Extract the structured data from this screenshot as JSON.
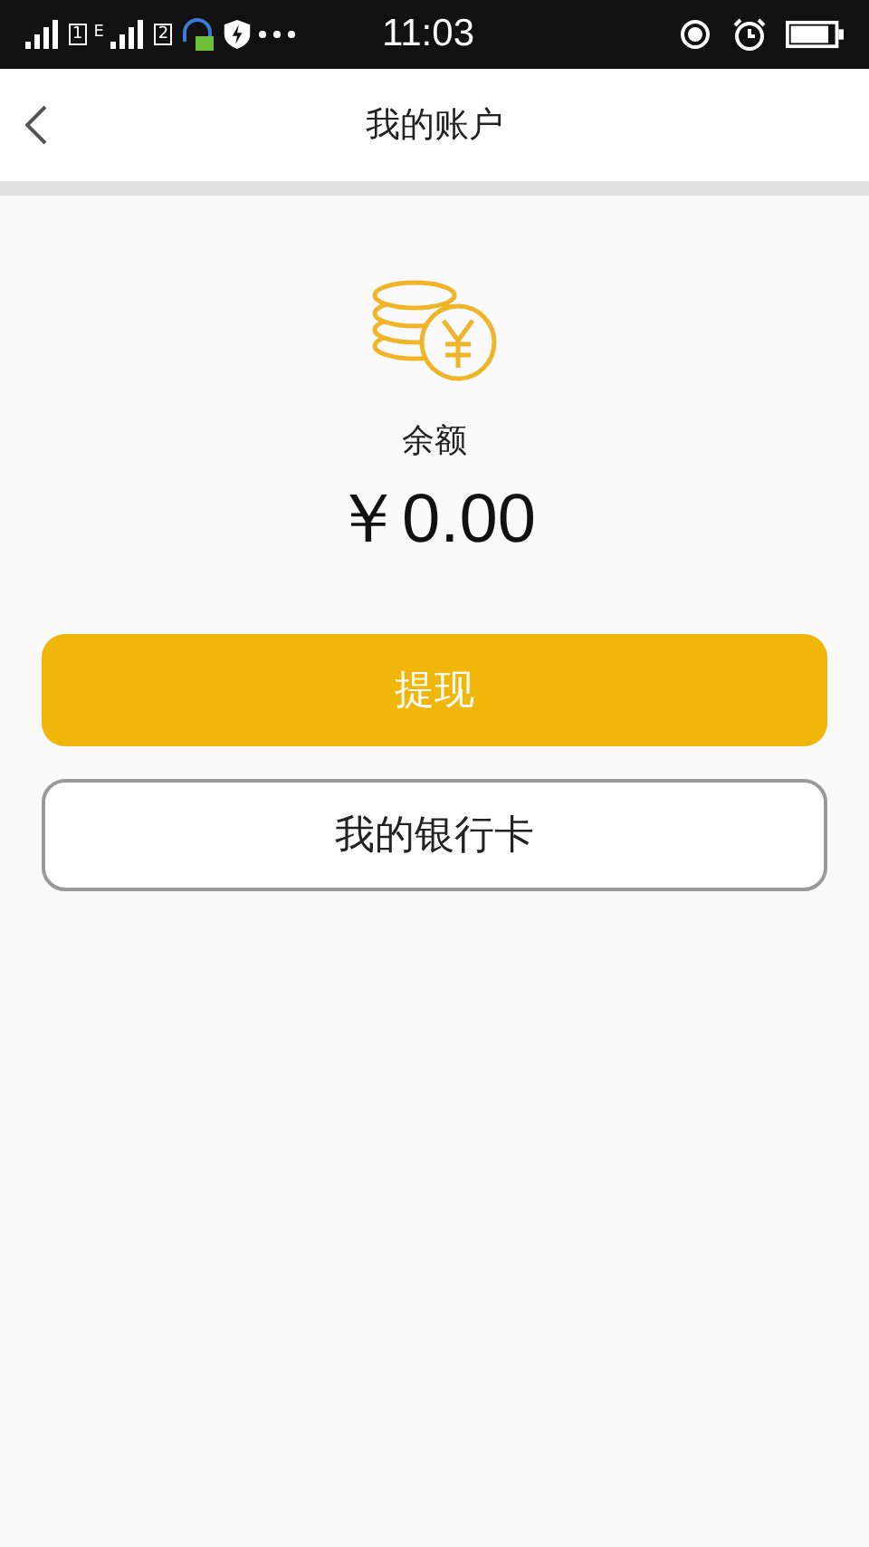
{
  "status_bar": {
    "sim_1": "1",
    "network_type": "E",
    "sim_2": "2",
    "time": "11:03"
  },
  "header": {
    "title": "我的账户"
  },
  "balance": {
    "label": "余额",
    "amount": "￥0.00"
  },
  "buttons": [
    {
      "label": "提现",
      "kind": "primary"
    },
    {
      "label": "我的银行卡",
      "kind": "outline"
    }
  ]
}
